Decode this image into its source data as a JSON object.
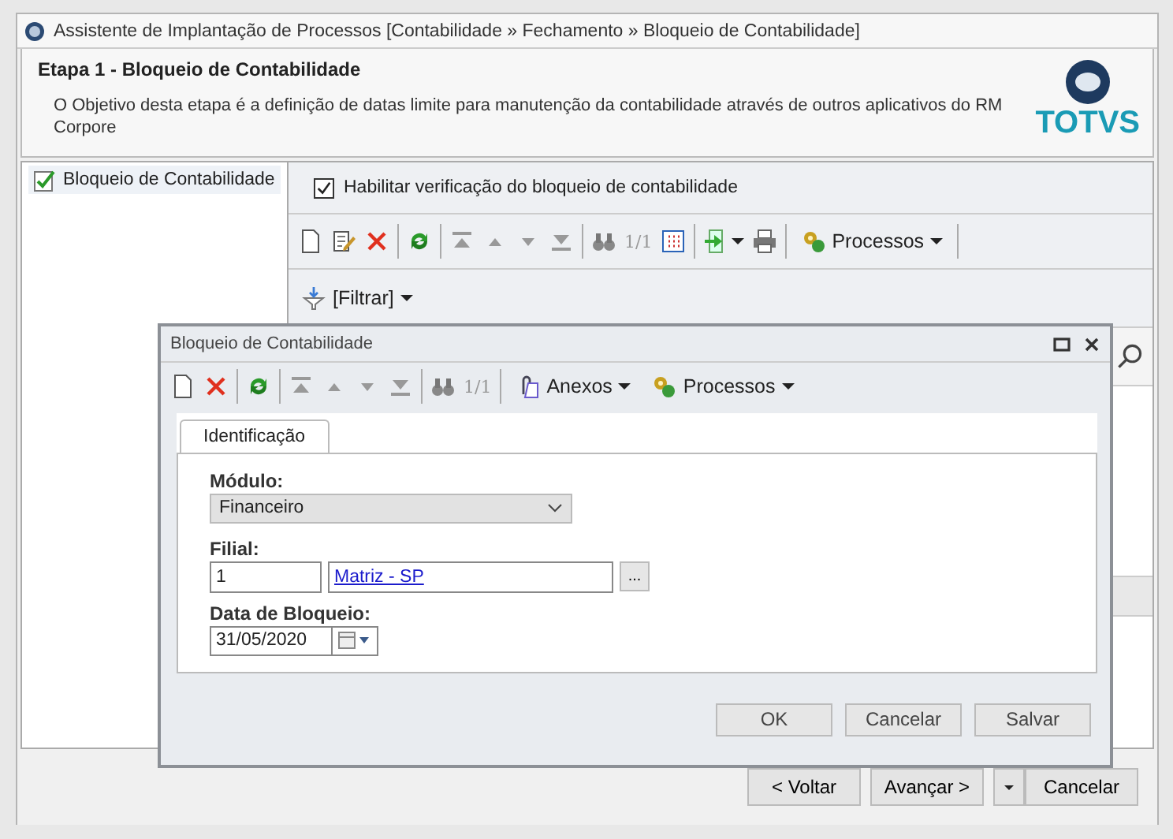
{
  "window": {
    "title": "Assistente de Implantação de Processos [Contabilidade » Fechamento » Bloqueio de Contabilidade]"
  },
  "header": {
    "title": "Etapa 1 - Bloqueio de Contabilidade",
    "description": "O Objetivo desta etapa é a definição de datas limite para manutenção da contabilidade através de outros aplicativos do RM Corpore",
    "logo": "TOTVS"
  },
  "tree": {
    "items": [
      {
        "label": "Bloqueio de Contabilidade",
        "selected": true
      }
    ]
  },
  "panel": {
    "checkbox": {
      "label": "Habilitar verificação do bloqueio de contabilidade",
      "checked": true
    },
    "toolbar": [
      {
        "kind": "new"
      },
      {
        "kind": "edit"
      },
      {
        "kind": "delete"
      },
      {
        "kind": "sep"
      },
      {
        "kind": "refresh"
      },
      {
        "kind": "sep"
      },
      {
        "kind": "first"
      },
      {
        "kind": "prev"
      },
      {
        "kind": "next"
      },
      {
        "kind": "last"
      },
      {
        "kind": "sep"
      },
      {
        "kind": "find"
      },
      {
        "kind": "counter",
        "label": "1/1"
      },
      {
        "kind": "grid"
      },
      {
        "kind": "sep"
      },
      {
        "kind": "export"
      },
      {
        "kind": "print"
      },
      {
        "kind": "sep"
      },
      {
        "kind": "menu",
        "label": "Processos"
      },
      {
        "kind": "sep"
      }
    ],
    "filter": "[Filtrar]"
  },
  "footer": {
    "buttons": [
      {
        "label": "< Voltar",
        "kind": "button"
      },
      {
        "label": "Avançar >",
        "kind": "button"
      },
      {
        "kind": "dropdown"
      },
      {
        "label": "Cancelar",
        "kind": "button"
      }
    ]
  },
  "dialog": {
    "title": "Bloqueio de Contabilidade",
    "toolbar": [
      {
        "kind": "new"
      },
      {
        "kind": "delete"
      },
      {
        "kind": "sep"
      },
      {
        "kind": "refresh"
      },
      {
        "kind": "sep"
      },
      {
        "kind": "first"
      },
      {
        "kind": "prev"
      },
      {
        "kind": "next"
      },
      {
        "kind": "last"
      },
      {
        "kind": "sep"
      },
      {
        "kind": "find"
      },
      {
        "kind": "counter",
        "label": "1/1"
      },
      {
        "kind": "sep"
      },
      {
        "kind": "attach",
        "label": "Anexos"
      },
      {
        "kind": "menu",
        "label": "Processos"
      }
    ],
    "tabs": [
      {
        "label": "Identificação",
        "selected": true
      }
    ],
    "modulo": {
      "label": "Módulo:",
      "value": "Financeiro"
    },
    "filial": {
      "label": "Filial:",
      "code": "1",
      "name": "Matriz - SP",
      "browse": "..."
    },
    "data": {
      "label": "Data de Bloqueio:",
      "value": "31/05/2020"
    },
    "buttons": [
      "OK",
      "Cancelar",
      "Salvar"
    ]
  }
}
